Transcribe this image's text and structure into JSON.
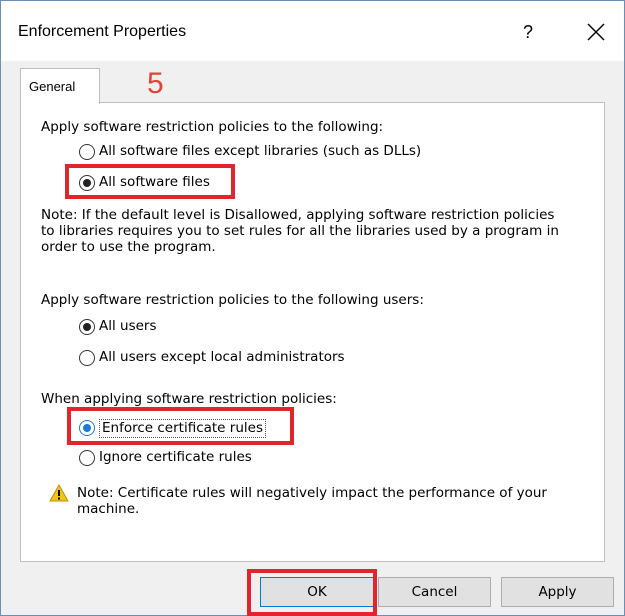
{
  "window": {
    "title": "Enforcement Properties",
    "help_label": "?"
  },
  "tabs": [
    {
      "label": "General"
    }
  ],
  "annotation": {
    "step": "5",
    "color": "#e0262b"
  },
  "section_files": {
    "heading": "Apply software restriction policies to the following:",
    "options": [
      {
        "label": "All software files except libraries (such as DLLs)",
        "checked": false
      },
      {
        "label": "All software files",
        "checked": true
      }
    ],
    "note_lines": [
      "Note:  If the default level is Disallowed, applying software restriction policies",
      "to libraries requires you to set rules for all the libraries used by a program in",
      "order to use the program."
    ]
  },
  "section_users": {
    "heading": "Apply software restriction policies to the following users:",
    "options": [
      {
        "label": "All users",
        "checked": true
      },
      {
        "label": "All users except local administrators",
        "checked": false
      }
    ]
  },
  "section_certs": {
    "heading": "When applying software restriction policies:",
    "options": [
      {
        "label": "Enforce certificate rules",
        "checked": true
      },
      {
        "label": "Ignore certificate rules",
        "checked": false
      }
    ]
  },
  "warning": {
    "icon": "warning-triangle-icon",
    "lines": [
      "Note:  Certificate rules will negatively impact the performance of your",
      "machine."
    ]
  },
  "buttons": {
    "ok": "OK",
    "cancel": "Cancel",
    "apply": "Apply"
  },
  "colors": {
    "accent": "#1e78d7",
    "highlight": "#e0262b",
    "warning": "#f2c511"
  }
}
